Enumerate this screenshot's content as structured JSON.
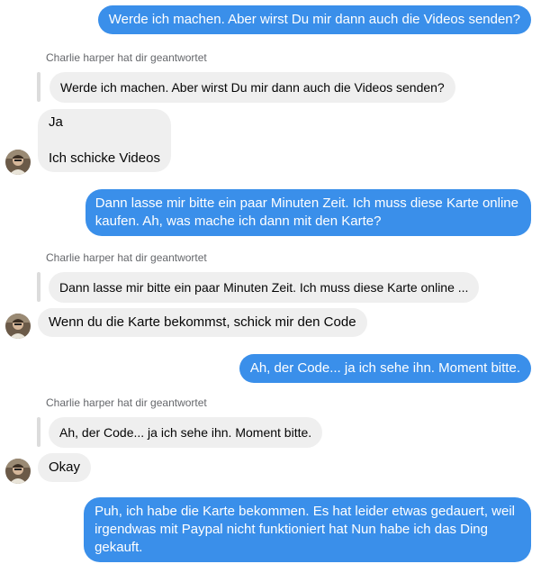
{
  "contact": {
    "name": "Charlie harper",
    "avatar_icon": "user-avatar-icon"
  },
  "colors": {
    "outgoing": "#3a8fea",
    "incoming": "#efefef",
    "reply_label": "#65676b"
  },
  "messages": [
    {
      "type": "outgoing",
      "text": "Werde ich machen. Aber wirst Du mir dann auch die Videos senden?"
    },
    {
      "type": "reply_label",
      "text": "Charlie harper hat dir geantwortet"
    },
    {
      "type": "quote",
      "text": "Werde ich machen. Aber wirst Du mir dann auch die Videos senden?"
    },
    {
      "type": "incoming",
      "lines": [
        "Ja",
        "",
        "Ich schicke Videos"
      ]
    },
    {
      "type": "outgoing",
      "lines": [
        "Dann lasse mir bitte ein paar Minuten Zeit. Ich muss diese Karte online",
        "kaufen. Ah, was mache ich dann mit den Karte?"
      ]
    },
    {
      "type": "reply_label",
      "text": "Charlie harper hat dir geantwortet"
    },
    {
      "type": "quote",
      "text": "Dann lasse mir bitte ein paar Minuten Zeit. Ich muss diese Karte online ..."
    },
    {
      "type": "incoming",
      "text": "Wenn du die Karte bekommst, schick mir den Code"
    },
    {
      "type": "outgoing",
      "text": "Ah, der Code... ja ich sehe ihn. Moment bitte."
    },
    {
      "type": "reply_label",
      "text": "Charlie harper hat dir geantwortet"
    },
    {
      "type": "quote",
      "text": "Ah, der Code... ja ich sehe ihn. Moment bitte."
    },
    {
      "type": "incoming",
      "text": "Okay"
    },
    {
      "type": "outgoing",
      "lines": [
        "Puh, ich habe die Karte bekommen. Es hat leider etwas gedauert, weil",
        "irgendwas mit Paypal nicht funktioniert hat Nun habe ich das Ding",
        "gekauft."
      ]
    }
  ]
}
